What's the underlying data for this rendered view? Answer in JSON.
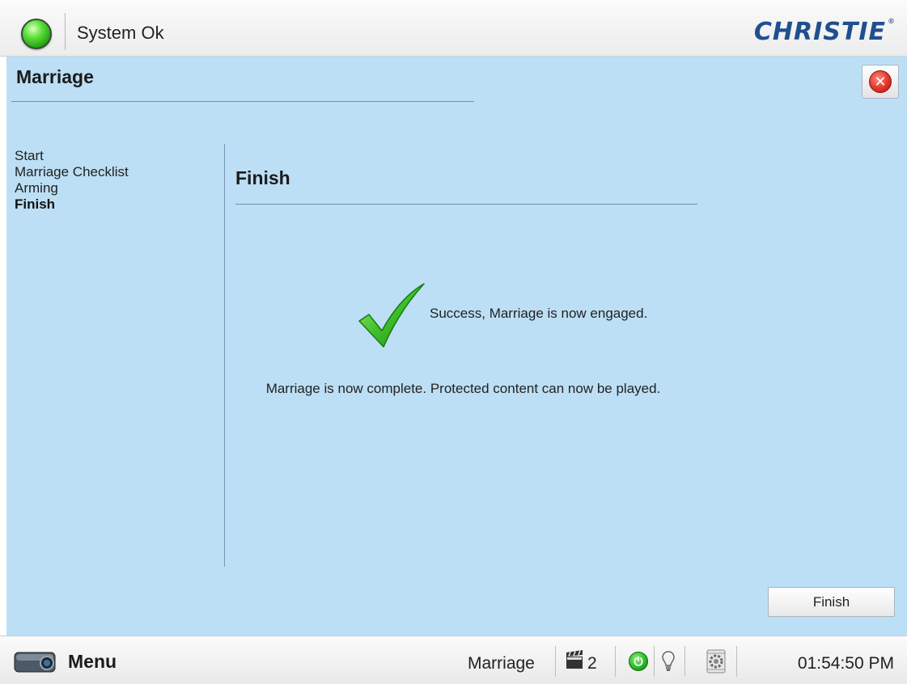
{
  "header": {
    "status_text": "System Ok",
    "status_color": "#2fc21f",
    "brand": "CHRISTIE",
    "brand_color": "#1f4f8f"
  },
  "page": {
    "title": "Marriage",
    "close_icon": "close-icon"
  },
  "steps": [
    {
      "label": "Start",
      "active": false
    },
    {
      "label": "Marriage Checklist",
      "active": false
    },
    {
      "label": "Arming",
      "active": false
    },
    {
      "label": "Finish",
      "active": true
    }
  ],
  "content": {
    "section_title": "Finish",
    "success_message": "Success, Marriage is now engaged.",
    "complete_message": "Marriage is now complete. Protected content can now be played.",
    "finish_button": "Finish",
    "icon": "checkmark-icon"
  },
  "footer": {
    "menu_label": "Menu",
    "mode": "Marriage",
    "screen_count": "2",
    "time": "01:54:50 PM",
    "icons": [
      "projector-icon",
      "clapperboard-icon",
      "power-icon",
      "bulb-icon",
      "gear-icon"
    ]
  },
  "colors": {
    "panel_background": "#bcdff5",
    "accent_rule": "#6f8fb0"
  }
}
